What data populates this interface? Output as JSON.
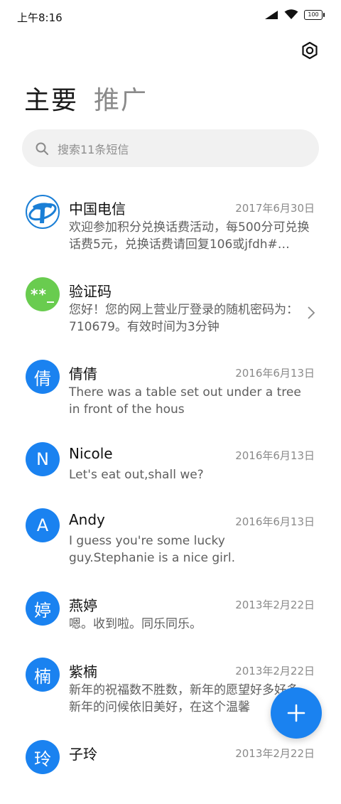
{
  "status": {
    "time": "上午8:16",
    "battery": "100"
  },
  "tabs": [
    {
      "label": "主要"
    },
    {
      "label": "推广"
    }
  ],
  "search": {
    "placeholder": "搜索11条短信"
  },
  "conversations": [
    {
      "name": "中国电信",
      "date": "2017年6月30日",
      "preview": "欢迎参加积分兑换话费活动，每500分可兑换话费5元，兑换话费请回复106或jfdh#…",
      "avatar_type": "telecom-logo"
    },
    {
      "name": "验证码",
      "date": "",
      "preview": "您好！您的网上营业厅登录的随机密码为：710679。有效时间为3分钟",
      "avatar_text": "**_",
      "avatar_color": "#69cc4f"
    },
    {
      "name": "倩倩",
      "date": "2016年6月13日",
      "preview": "There was a table set out under a tree in front of the hous",
      "avatar_text": "倩"
    },
    {
      "name": "Nicole",
      "date": "2016年6月13日",
      "preview": "Let's eat out,shall we?",
      "avatar_text": "N"
    },
    {
      "name": "Andy",
      "date": "2016年6月13日",
      "preview": "I guess you're some lucky guy.Stephanie is a nice girl.",
      "avatar_text": "A"
    },
    {
      "name": "燕婷",
      "date": "2013年2月22日",
      "preview": "嗯。收到啦。同乐同乐。",
      "avatar_text": "婷"
    },
    {
      "name": "紫楠",
      "date": "2013年2月22日",
      "preview": "新年的祝福数不胜数，新年的愿望好多好多，新年的问候依旧美好，在这个温馨",
      "avatar_text": "楠"
    },
    {
      "name": "子玲",
      "date": "2013年2月22日",
      "preview": "",
      "avatar_text": "玲"
    }
  ],
  "colors": {
    "accent": "#1a82f0",
    "verify_green": "#69cc4f"
  },
  "icons": {
    "settings": "settings-icon",
    "search": "search-icon",
    "compose": "plus-icon"
  }
}
